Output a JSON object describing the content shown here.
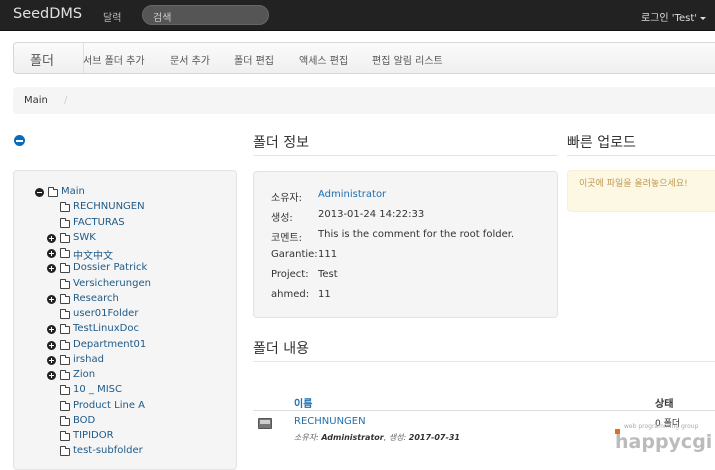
{
  "navbar": {
    "brand": "SeedDMS",
    "calendar": "달력",
    "search_placeholder": "검색",
    "login": "로그인 'Test'"
  },
  "subnav": {
    "title": "폴더",
    "items": [
      "서브 폴더 추가",
      "문서 추가",
      "폴더 편집",
      "액세스 편집",
      "편집 알림 리스트"
    ]
  },
  "breadcrumb": {
    "crumb": "Main",
    "divider": "/"
  },
  "tree": [
    {
      "label": "Main",
      "toggle": "minus",
      "level": 0
    },
    {
      "label": "RECHNUNGEN",
      "toggle": "none",
      "level": 1
    },
    {
      "label": "FACTURAS",
      "toggle": "none",
      "level": 1
    },
    {
      "label": "SWK",
      "toggle": "plus",
      "level": 1
    },
    {
      "label": "中文中文",
      "toggle": "plus",
      "level": 1
    },
    {
      "label": "Dossier Patrick",
      "toggle": "plus",
      "level": 1
    },
    {
      "label": "Versicherungen",
      "toggle": "none",
      "level": 1
    },
    {
      "label": "Research",
      "toggle": "plus",
      "level": 1
    },
    {
      "label": "user01Folder",
      "toggle": "none",
      "level": 1
    },
    {
      "label": "TestLinuxDoc",
      "toggle": "plus",
      "level": 1
    },
    {
      "label": "Department01",
      "toggle": "plus",
      "level": 1
    },
    {
      "label": "irshad",
      "toggle": "plus",
      "level": 1
    },
    {
      "label": "Zion",
      "toggle": "plus",
      "level": 1
    },
    {
      "label": "10 _ MISC",
      "toggle": "none",
      "level": 1
    },
    {
      "label": "Product Line A",
      "toggle": "none",
      "level": 1
    },
    {
      "label": "BOD",
      "toggle": "none",
      "level": 1
    },
    {
      "label": "TIPIDOR",
      "toggle": "none",
      "level": 1
    },
    {
      "label": "test-subfolder",
      "toggle": "none",
      "level": 1
    }
  ],
  "folder_info": {
    "heading": "폴더 정보",
    "rows": [
      {
        "key": "소유자:",
        "value": "Administrator",
        "link": true
      },
      {
        "key": "생성:",
        "value": "2013-01-24 14:22:33",
        "link": false
      },
      {
        "key": "코멘트:",
        "value": "This is the comment for the root folder.",
        "link": false
      },
      {
        "key": "Garantie:",
        "value": "111",
        "link": false
      },
      {
        "key": "Project:",
        "value": "Test",
        "link": false
      },
      {
        "key": "ahmed:",
        "value": "11",
        "link": false
      }
    ]
  },
  "contents": {
    "heading": "폴더 내용",
    "col_name": "이름",
    "col_status": "상태",
    "row": {
      "name": "RECHNUNGEN",
      "meta_owner_label": "소유자:",
      "meta_owner": "Administrator",
      "meta_created_label": "생성:",
      "meta_created": "2017-07-31",
      "status": "0 폴더"
    }
  },
  "quick_upload": {
    "heading": "빠른 업로드",
    "text": "이곳에 파일을 올려놓으세요!"
  },
  "watermark": {
    "text": "happycgi",
    "sub": "web programming group"
  },
  "colors": {
    "navbar": "#222222",
    "link": "#1e6fb0",
    "upload_bg": "#fcf8e3",
    "upload_text": "#c09853"
  }
}
